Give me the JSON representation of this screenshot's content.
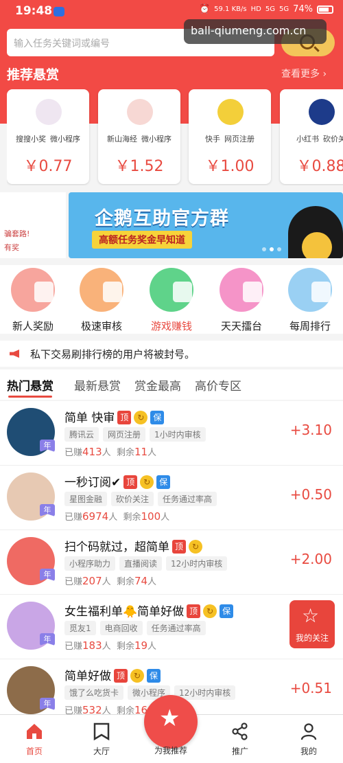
{
  "status": {
    "time": "19:48",
    "net_speed": "59.1",
    "net_unit": "KB/s",
    "hd": "HD",
    "sig1": "5G",
    "sig2": "5G",
    "battery": "74%"
  },
  "watermark": "ball-qiumeng.com.cn",
  "search": {
    "placeholder": "输入任务关键词或编号"
  },
  "recommend": {
    "title": "推荐悬赏",
    "more": "查看更多 ›",
    "cards": [
      {
        "tag1": "搜搜小奖",
        "tag2": "微小程序",
        "price": "￥0.77",
        "color": "#efe6f1"
      },
      {
        "tag1": "新山海经",
        "tag2": "微小程序",
        "price": "￥1.52",
        "color": "#f7d8d4"
      },
      {
        "tag1": "快手",
        "tag2": "网页注册",
        "price": "￥1.00",
        "color": "#f3cf3a"
      },
      {
        "tag1": "小红书",
        "tag2": "砍价关",
        "price": "￥0.88",
        "color": "#1d3b8a"
      }
    ]
  },
  "banner": {
    "side_line1": "骗套路!",
    "side_line2": "有奖",
    "title": "企鹅互助官方群",
    "subtitle": "高额任务奖金早知道"
  },
  "categories": [
    {
      "label": "新人奖励",
      "color": "#f7a59d"
    },
    {
      "label": "极速审核",
      "color": "#f9b27a"
    },
    {
      "label": "游戏赚钱",
      "color": "#5fd38a"
    },
    {
      "label": "天天擂台",
      "color": "#f594c8"
    },
    {
      "label": "每周排行",
      "color": "#9ad0f3"
    }
  ],
  "notice": "私下交易刷排行榜的用户将被封号。",
  "tabs": [
    "热门悬赏",
    "最新悬赏",
    "赏金最高",
    "高价专区"
  ],
  "badges": {
    "top": "顶",
    "ok": "↻",
    "bao": "保",
    "year": "年"
  },
  "tasks": [
    {
      "title": "简单 快审",
      "badges": [
        "top",
        "ok",
        "bao"
      ],
      "chips": [
        "腾讯云",
        "网页注册",
        "1小时内审核"
      ],
      "earned_prefix": "已赚",
      "earned": "413",
      "earned_suffix": "人",
      "left_prefix": "剩余",
      "left": "11",
      "left_suffix": "人",
      "amount": "+3.10",
      "avatar_color": "#1f4d74"
    },
    {
      "title": "一秒订阅✔",
      "badges": [
        "top",
        "ok",
        "bao"
      ],
      "chips": [
        "星图金融",
        "砍价关注",
        "任务通过率高"
      ],
      "earned_prefix": "已赚",
      "earned": "6974",
      "earned_suffix": "人",
      "left_prefix": "剩余",
      "left": "100",
      "left_suffix": "人",
      "amount": "+0.50",
      "avatar_color": "#e7c9b3"
    },
    {
      "title": "扫个码就过，超简单",
      "badges": [
        "top",
        "ok"
      ],
      "chips": [
        "小程序助力",
        "直播阅读",
        "12小时内审核"
      ],
      "earned_prefix": "已赚",
      "earned": "207",
      "earned_suffix": "人",
      "left_prefix": "剩余",
      "left": "74",
      "left_suffix": "人",
      "amount": "+2.00",
      "avatar_color": "#ef6a63"
    },
    {
      "title": "女生福利单🐥简单好做",
      "badges": [
        "top",
        "ok",
        "bao"
      ],
      "chips": [
        "觅友1",
        "电商回收",
        "任务通过率高"
      ],
      "earned_prefix": "已赚",
      "earned": "183",
      "earned_suffix": "人",
      "left_prefix": "剩余",
      "left": "19",
      "left_suffix": "人",
      "amount": "",
      "avatar_color": "#c9a6e6"
    },
    {
      "title": "简单好做",
      "badges": [
        "top",
        "ok",
        "bao"
      ],
      "chips": [
        "饿了么吃货卡",
        "微小程序",
        "12小时内审核"
      ],
      "earned_prefix": "已赚",
      "earned": "532",
      "earned_suffix": "人",
      "left_prefix": "剩余",
      "left": "16",
      "left_suffix": "",
      "amount": "+0.51",
      "avatar_color": "#8d6c4a"
    }
  ],
  "fav": {
    "label": "我的关注"
  },
  "nav": [
    {
      "label": "首页",
      "icon": "home-icon",
      "active": true
    },
    {
      "label": "大厅",
      "icon": "hall-icon",
      "active": false
    },
    {
      "label": "为我推荐",
      "icon": "star-icon",
      "active": false
    },
    {
      "label": "推广",
      "icon": "share-icon",
      "active": false
    },
    {
      "label": "我的",
      "icon": "user-icon",
      "active": false
    }
  ],
  "colors": {
    "brand_red": "#f24a45",
    "price_red": "#e84a40",
    "search_btn": "#f3c55a"
  }
}
